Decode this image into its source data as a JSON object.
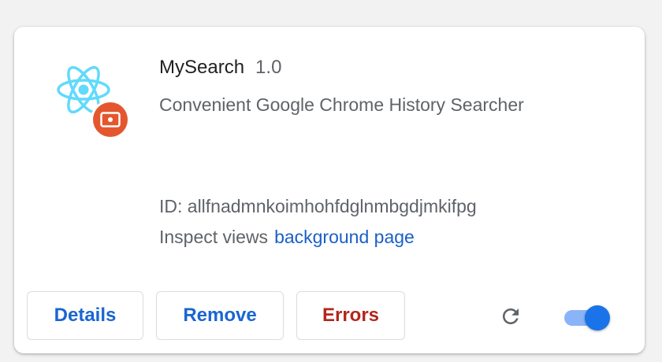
{
  "extension": {
    "name": "MySearch",
    "version": "1.0",
    "description": "Convenient Google Chrome History Searcher",
    "id_text": "ID: allfnadmnkoimhohfdglnmbgdjmkifpg",
    "inspect_label": "Inspect views",
    "inspect_link": "background page",
    "icon": "react-atom-icon",
    "badge_icon": "hard-drive-icon",
    "enabled": true
  },
  "actions": {
    "details_label": "Details",
    "remove_label": "Remove",
    "errors_label": "Errors",
    "reload_icon": "reload-icon"
  },
  "colors": {
    "link": "#1a5fc8",
    "primary_button_text": "#1a66d2",
    "error_button_text": "#b3261e",
    "react_blue": "#61dafb",
    "badge_orange": "#e4572e",
    "toggle_knob": "#1a73e8",
    "toggle_track": "#8ab4f8"
  }
}
